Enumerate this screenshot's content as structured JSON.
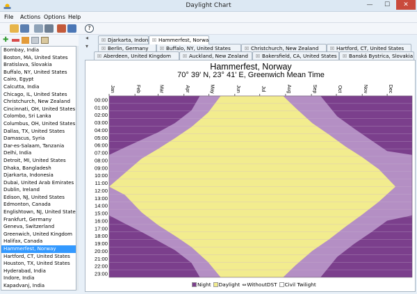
{
  "window": {
    "title": "Daylight Chart",
    "controls": {
      "minimize": "—",
      "maximize": "☐",
      "close": "✕"
    }
  },
  "menu": [
    "File",
    "Actions",
    "Options",
    "Help"
  ],
  "toolbar_icons": [
    "open-folder-icon",
    "save-icon",
    "print-preview-icon",
    "print-icon",
    "export-icon",
    "calendar-icon",
    "options-icon",
    "help-icon"
  ],
  "list_toolbar_icons": [
    "add-location-icon",
    "remove-location-icon",
    "edit-location-icon",
    "copy-location-icon",
    "paste-location-icon"
  ],
  "cities": [
    "Bombay, India",
    "Boston, MA, United States",
    "Bratislava, Slovakia",
    "Buffalo, NY, United States",
    "Cairo, Egypt",
    "Calcutta, India",
    "Chicago, IL, United States",
    "Christchurch, New Zealand",
    "Cincinnati, OH, United States",
    "Colombo, Sri Lanka",
    "Columbus, OH, United States",
    "Dallas, TX, United States",
    "Damascus, Syria",
    "Dar-es-Salaam, Tanzania",
    "Delhi, India",
    "Detroit, MI, United States",
    "Dhaka, Bangladesh",
    "Djarkarta, Indonesia",
    "Dubai, United Arab Emirates",
    "Dublin, Ireland",
    "Edison, NJ, United States",
    "Edmonton, Canada",
    "Englishtown, NJ, United States",
    "Frankfurt, Germany",
    "Geneva, Switzerland",
    "Greenwich, United Kingdom",
    "Halifax, Canada",
    "Hammerfest, Norway",
    "Hartford, CT, United States",
    "Houston, TX, United States",
    "Hyderabad, India",
    "Indore, India",
    "Kapadvanj, India"
  ],
  "selected_city": "Hammerfest, Norway",
  "tab_rows": [
    [
      {
        "label": "Djarkarta, Indonesia"
      },
      {
        "label": "Hammerfest, Norway",
        "active": true
      }
    ],
    [
      {
        "label": "Berlin, Germany"
      },
      {
        "label": "Buffalo, NY, United States"
      },
      {
        "label": "Christchurch, New Zealand"
      },
      {
        "label": "Hartford, CT, United States"
      }
    ],
    [
      {
        "label": "Aberdeen, United Kingdom"
      },
      {
        "label": "Auckland, New Zealand"
      },
      {
        "label": "Bakersfield, CA, United States"
      },
      {
        "label": "Banská Bystrica, Slovakia"
      }
    ]
  ],
  "chart": {
    "title": "Hammerfest, Norway",
    "subtitle": "70° 39' N, 23° 41' E, Greenwich Mean Time"
  },
  "legend": [
    {
      "label": "Night",
      "color": "#7b3f8c"
    },
    {
      "label": "Daylight",
      "color": "#f2ec8e"
    },
    {
      "label": "WithoutDST",
      "color": "",
      "icon": "arrow-both-icon"
    },
    {
      "label": "Civil Twilight",
      "color": "#ffffff"
    }
  ],
  "chart_data": {
    "type": "area",
    "x_label_months": [
      "Jan",
      "Feb",
      "Mar",
      "Apr",
      "May",
      "Jun",
      "Jul",
      "Aug",
      "Sep",
      "Oct",
      "Nov",
      "Dec"
    ],
    "y_ticks": [
      "00:00",
      "01:00",
      "02:00",
      "03:00",
      "04:00",
      "05:00",
      "06:00",
      "07:00",
      "08:00",
      "09:00",
      "10:00",
      "11:00",
      "12:00",
      "13:00",
      "14:00",
      "15:00",
      "16:00",
      "17:00",
      "18:00",
      "19:00",
      "20:00",
      "21:00",
      "22:00",
      "23:00"
    ],
    "ylim": [
      "00:00",
      "24:00"
    ],
    "colors": {
      "night": "#7b3f8c",
      "twilight": "#b48fc4",
      "daylight": "#f2ec8e",
      "grid": "#c9b3d2"
    },
    "series": [
      {
        "name": "Daylight",
        "x_day": [
          1,
          20,
          40,
          60,
          80,
          100,
          120,
          135,
          210,
          225,
          245,
          265,
          285,
          305,
          325,
          345,
          365
        ],
        "sunrise_hour": [
          12.0,
          10.2,
          8.3,
          7.0,
          5.6,
          4.1,
          2.2,
          0,
          0,
          1.6,
          3.6,
          5.1,
          6.7,
          8.1,
          9.7,
          12.0,
          12.0
        ],
        "sunset_hour": [
          12.0,
          13.1,
          15.4,
          17.1,
          18.5,
          20.0,
          22.0,
          24,
          24,
          22.4,
          20.5,
          19.0,
          17.3,
          15.7,
          14.0,
          12.0,
          12.0
        ]
      },
      {
        "name": "Civil Twilight",
        "x_day": [
          1,
          20,
          40,
          60,
          80,
          100,
          110,
          255,
          275,
          295,
          315,
          335,
          365
        ],
        "dawn_hour": [
          7.8,
          6.8,
          5.8,
          4.8,
          3.6,
          1.9,
          0,
          0,
          2.7,
          4.3,
          5.8,
          7.3,
          7.8
        ],
        "dusk_hour": [
          15.8,
          16.9,
          18.0,
          19.2,
          20.4,
          22.1,
          24,
          24,
          21.3,
          19.6,
          18.1,
          16.5,
          15.8
        ]
      }
    ]
  }
}
